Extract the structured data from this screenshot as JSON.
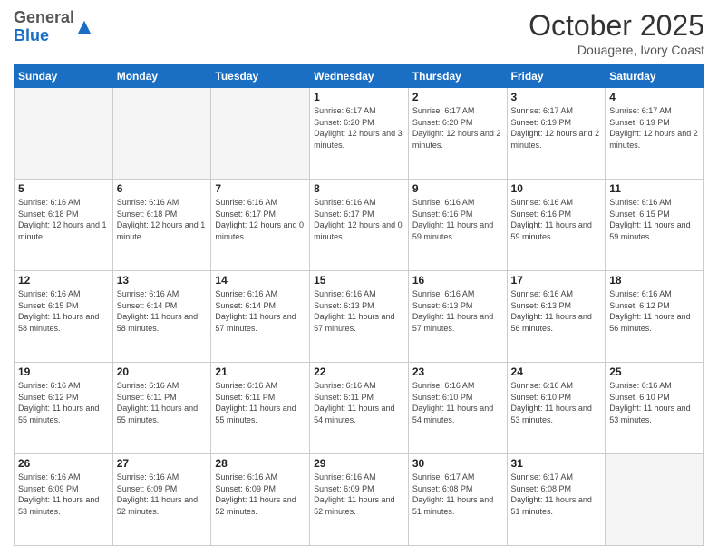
{
  "logo": {
    "general": "General",
    "blue": "Blue"
  },
  "header": {
    "month": "October 2025",
    "location": "Douagere, Ivory Coast"
  },
  "days_of_week": [
    "Sunday",
    "Monday",
    "Tuesday",
    "Wednesday",
    "Thursday",
    "Friday",
    "Saturday"
  ],
  "weeks": [
    [
      {
        "day": "",
        "info": ""
      },
      {
        "day": "",
        "info": ""
      },
      {
        "day": "",
        "info": ""
      },
      {
        "day": "1",
        "info": "Sunrise: 6:17 AM\nSunset: 6:20 PM\nDaylight: 12 hours and 3 minutes."
      },
      {
        "day": "2",
        "info": "Sunrise: 6:17 AM\nSunset: 6:20 PM\nDaylight: 12 hours and 2 minutes."
      },
      {
        "day": "3",
        "info": "Sunrise: 6:17 AM\nSunset: 6:19 PM\nDaylight: 12 hours and 2 minutes."
      },
      {
        "day": "4",
        "info": "Sunrise: 6:17 AM\nSunset: 6:19 PM\nDaylight: 12 hours and 2 minutes."
      }
    ],
    [
      {
        "day": "5",
        "info": "Sunrise: 6:16 AM\nSunset: 6:18 PM\nDaylight: 12 hours and 1 minute."
      },
      {
        "day": "6",
        "info": "Sunrise: 6:16 AM\nSunset: 6:18 PM\nDaylight: 12 hours and 1 minute."
      },
      {
        "day": "7",
        "info": "Sunrise: 6:16 AM\nSunset: 6:17 PM\nDaylight: 12 hours and 0 minutes."
      },
      {
        "day": "8",
        "info": "Sunrise: 6:16 AM\nSunset: 6:17 PM\nDaylight: 12 hours and 0 minutes."
      },
      {
        "day": "9",
        "info": "Sunrise: 6:16 AM\nSunset: 6:16 PM\nDaylight: 11 hours and 59 minutes."
      },
      {
        "day": "10",
        "info": "Sunrise: 6:16 AM\nSunset: 6:16 PM\nDaylight: 11 hours and 59 minutes."
      },
      {
        "day": "11",
        "info": "Sunrise: 6:16 AM\nSunset: 6:15 PM\nDaylight: 11 hours and 59 minutes."
      }
    ],
    [
      {
        "day": "12",
        "info": "Sunrise: 6:16 AM\nSunset: 6:15 PM\nDaylight: 11 hours and 58 minutes."
      },
      {
        "day": "13",
        "info": "Sunrise: 6:16 AM\nSunset: 6:14 PM\nDaylight: 11 hours and 58 minutes."
      },
      {
        "day": "14",
        "info": "Sunrise: 6:16 AM\nSunset: 6:14 PM\nDaylight: 11 hours and 57 minutes."
      },
      {
        "day": "15",
        "info": "Sunrise: 6:16 AM\nSunset: 6:13 PM\nDaylight: 11 hours and 57 minutes."
      },
      {
        "day": "16",
        "info": "Sunrise: 6:16 AM\nSunset: 6:13 PM\nDaylight: 11 hours and 57 minutes."
      },
      {
        "day": "17",
        "info": "Sunrise: 6:16 AM\nSunset: 6:13 PM\nDaylight: 11 hours and 56 minutes."
      },
      {
        "day": "18",
        "info": "Sunrise: 6:16 AM\nSunset: 6:12 PM\nDaylight: 11 hours and 56 minutes."
      }
    ],
    [
      {
        "day": "19",
        "info": "Sunrise: 6:16 AM\nSunset: 6:12 PM\nDaylight: 11 hours and 55 minutes."
      },
      {
        "day": "20",
        "info": "Sunrise: 6:16 AM\nSunset: 6:11 PM\nDaylight: 11 hours and 55 minutes."
      },
      {
        "day": "21",
        "info": "Sunrise: 6:16 AM\nSunset: 6:11 PM\nDaylight: 11 hours and 55 minutes."
      },
      {
        "day": "22",
        "info": "Sunrise: 6:16 AM\nSunset: 6:11 PM\nDaylight: 11 hours and 54 minutes."
      },
      {
        "day": "23",
        "info": "Sunrise: 6:16 AM\nSunset: 6:10 PM\nDaylight: 11 hours and 54 minutes."
      },
      {
        "day": "24",
        "info": "Sunrise: 6:16 AM\nSunset: 6:10 PM\nDaylight: 11 hours and 53 minutes."
      },
      {
        "day": "25",
        "info": "Sunrise: 6:16 AM\nSunset: 6:10 PM\nDaylight: 11 hours and 53 minutes."
      }
    ],
    [
      {
        "day": "26",
        "info": "Sunrise: 6:16 AM\nSunset: 6:09 PM\nDaylight: 11 hours and 53 minutes."
      },
      {
        "day": "27",
        "info": "Sunrise: 6:16 AM\nSunset: 6:09 PM\nDaylight: 11 hours and 52 minutes."
      },
      {
        "day": "28",
        "info": "Sunrise: 6:16 AM\nSunset: 6:09 PM\nDaylight: 11 hours and 52 minutes."
      },
      {
        "day": "29",
        "info": "Sunrise: 6:16 AM\nSunset: 6:09 PM\nDaylight: 11 hours and 52 minutes."
      },
      {
        "day": "30",
        "info": "Sunrise: 6:17 AM\nSunset: 6:08 PM\nDaylight: 11 hours and 51 minutes."
      },
      {
        "day": "31",
        "info": "Sunrise: 6:17 AM\nSunset: 6:08 PM\nDaylight: 11 hours and 51 minutes."
      },
      {
        "day": "",
        "info": ""
      }
    ]
  ]
}
